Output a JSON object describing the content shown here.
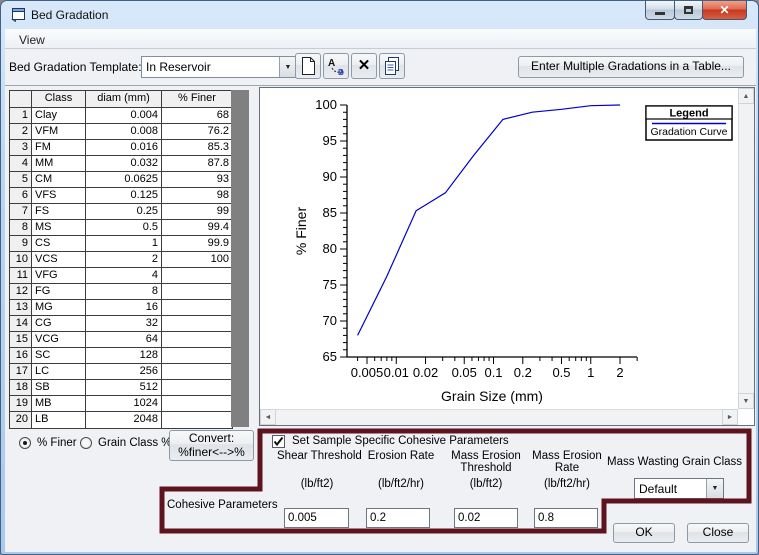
{
  "window": {
    "title": "Bed Gradation"
  },
  "icons": {
    "close_glyph": "✕",
    "combo_arrow": "▼",
    "scroll_up": "▲",
    "scroll_down": "▼",
    "scroll_left": "◄",
    "scroll_right": "►",
    "delete_glyph": "✕",
    "rename_a": "A",
    "rename_b": "B"
  },
  "menu": {
    "view_label": "View"
  },
  "toolbar": {
    "template_label": "Bed Gradation Template:",
    "template_value": "In Reservoir",
    "enter_multiple_button": "Enter Multiple Gradations in a Table..."
  },
  "table": {
    "columns": [
      "",
      "Class",
      "diam (mm)",
      "% Finer"
    ],
    "rows": [
      [
        "1",
        "Clay",
        "0.004",
        "68"
      ],
      [
        "2",
        "VFM",
        "0.008",
        "76.2"
      ],
      [
        "3",
        "FM",
        "0.016",
        "85.3"
      ],
      [
        "4",
        "MM",
        "0.032",
        "87.8"
      ],
      [
        "5",
        "CM",
        "0.0625",
        "93"
      ],
      [
        "6",
        "VFS",
        "0.125",
        "98"
      ],
      [
        "7",
        "FS",
        "0.25",
        "99"
      ],
      [
        "8",
        "MS",
        "0.5",
        "99.4"
      ],
      [
        "9",
        "CS",
        "1",
        "99.9"
      ],
      [
        "10",
        "VCS",
        "2",
        "100"
      ],
      [
        "11",
        "VFG",
        "4",
        ""
      ],
      [
        "12",
        "FG",
        "8",
        ""
      ],
      [
        "13",
        "MG",
        "16",
        ""
      ],
      [
        "14",
        "CG",
        "32",
        ""
      ],
      [
        "15",
        "VCG",
        "64",
        ""
      ],
      [
        "16",
        "SC",
        "128",
        ""
      ],
      [
        "17",
        "LC",
        "256",
        ""
      ],
      [
        "18",
        "SB",
        "512",
        ""
      ],
      [
        "19",
        "MB",
        "1024",
        ""
      ],
      [
        "20",
        "LB",
        "2048",
        ""
      ]
    ]
  },
  "chart_data": {
    "type": "line",
    "title": "",
    "xlabel": "Grain Size (mm)",
    "ylabel": "% Finer",
    "x_scale": "log",
    "xlim": [
      0.0031,
      3.0
    ],
    "ylim": [
      65,
      100
    ],
    "x_ticks": [
      0.005,
      0.01,
      0.02,
      0.05,
      0.1,
      0.2,
      0.5,
      1,
      2
    ],
    "y_ticks": [
      65,
      70,
      75,
      80,
      85,
      90,
      95,
      100
    ],
    "grid": false,
    "legend": {
      "position": "top-right",
      "title": "Legend",
      "entries": [
        "Gradation Curve"
      ]
    },
    "series": [
      {
        "name": "Gradation Curve",
        "color": "#0000C8",
        "x": [
          0.004,
          0.008,
          0.016,
          0.032,
          0.0625,
          0.125,
          0.25,
          0.5,
          1,
          2
        ],
        "y": [
          68,
          76.2,
          85.3,
          87.8,
          93,
          98,
          99,
          99.4,
          99.9,
          100
        ]
      }
    ]
  },
  "bottom": {
    "radio_finer_label": "% Finer",
    "radio_finer_selected": true,
    "radio_grain_label": "Grain Class %",
    "radio_grain_selected": false,
    "convert_line1": "Convert:",
    "convert_line2": "%finer<-->%",
    "checkbox_label": "Set Sample Specific Cohesive Parameters",
    "checkbox_checked": true,
    "cohesive_label": "Cohesive Parameters",
    "fields": [
      {
        "label1": "Shear Threshold",
        "label2": "",
        "unit": "(lb/ft2)",
        "value": "0.005"
      },
      {
        "label1": "Erosion Rate",
        "label2": "",
        "unit": "(lb/ft2/hr)",
        "value": "0.2"
      },
      {
        "label1": "Mass Erosion",
        "label2": "Threshold",
        "unit": "(lb/ft2)",
        "value": "0.02"
      },
      {
        "label1": "Mass Erosion",
        "label2": "Rate",
        "unit": "(lb/ft2/hr)",
        "value": "0.8"
      }
    ],
    "mass_wasting_label": "Mass Wasting Grain Class",
    "mass_wasting_value": "Default",
    "ok_label": "OK",
    "close_label": "Close"
  },
  "colors": {
    "highlight_maroon": "#5e141e",
    "curve_blue": "#0000C8",
    "titlebar_blue": "#bcd6f0",
    "gray_strip": "#808080"
  }
}
